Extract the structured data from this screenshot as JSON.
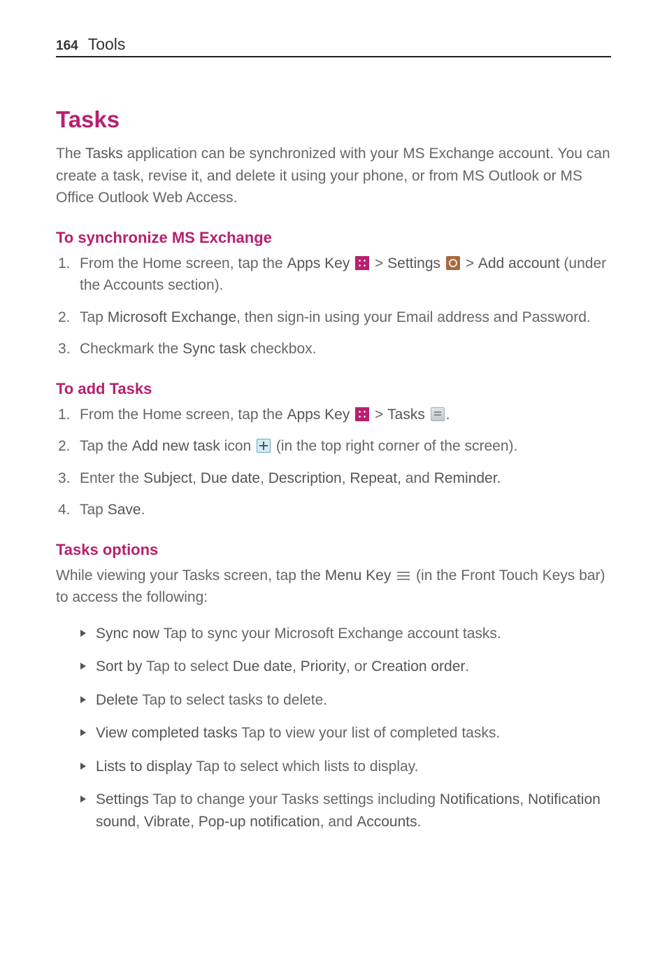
{
  "page_number": "164",
  "section_name": "Tools",
  "title": "Tasks",
  "intro": {
    "pre": "The ",
    "b1": "Tasks",
    "post": " application can be synchronized with your MS Exchange account. You can create a task, revise it, and delete it using your phone, or from MS Outlook or MS Office Outlook Web Access."
  },
  "h_sync": "To synchronize MS Exchange",
  "sync_steps": {
    "s1": {
      "num": "1.",
      "a": "From the Home screen, tap the ",
      "b1": "Apps Key",
      "sep1": " > ",
      "b2": "Settings",
      "sep2": " > ",
      "b3": "Add account",
      "tail": " (under the Accounts section)."
    },
    "s2": {
      "num": "2.",
      "a": "Tap ",
      "b1": "Microsoft Exchange",
      "tail": ", then sign-in using your Email address and Password."
    },
    "s3": {
      "num": "3.",
      "a": "Checkmark the ",
      "b1": "Sync task",
      "tail": " checkbox."
    }
  },
  "h_add": "To add Tasks",
  "add_steps": {
    "s1": {
      "num": "1.",
      "a": "From the Home screen, tap the ",
      "b1": "Apps Key",
      "sep1": " > ",
      "b2": "Tasks",
      "tail": "."
    },
    "s2": {
      "num": "2.",
      "a": "Tap the ",
      "b1": "Add new task",
      "mid": " icon ",
      "tail": " (in the top right corner of the screen)."
    },
    "s3": {
      "num": "3.",
      "a": "Enter the ",
      "b1": "Subject",
      "c1": ", ",
      "b2": "Due date",
      "c2": ", ",
      "b3": "Description",
      "c3": ", ",
      "b4": "Repeat,",
      "c4": " and ",
      "b5": "Reminder."
    },
    "s4": {
      "num": "4.",
      "a": "Tap ",
      "b1": "Save",
      "tail": "."
    }
  },
  "h_opts": "Tasks options",
  "opts_intro": {
    "a": "While viewing your Tasks screen, tap the ",
    "b1": "Menu Key",
    "tail": " (in the Front Touch Keys bar) to access the following:"
  },
  "opts": {
    "o1": {
      "b": "Sync now",
      "t": " Tap to sync your Microsoft Exchange account tasks."
    },
    "o2": {
      "b": "Sort by",
      "t1": " Tap to select ",
      "b2": "Due date",
      "c1": ", ",
      "b3": "Priority",
      "c2": ", or ",
      "b4": "Creation order",
      "tail": "."
    },
    "o3": {
      "b": "Delete",
      "t": " Tap to select tasks to delete."
    },
    "o4": {
      "b": "View completed tasks",
      "t": " Tap to view your list of completed tasks."
    },
    "o5": {
      "b": "Lists to display",
      "t": " Tap to select which lists to display."
    },
    "o6": {
      "b": "Settings",
      "t1": " Tap to change your Tasks settings including ",
      "b2": "Notifications",
      "c1": ", ",
      "b3": "Notification sound",
      "c2": ", ",
      "b4": "Vibrate",
      "c3": ", ",
      "b5": "Pop-up notification",
      "c4": ", and ",
      "b6": "Accounts",
      "tail": "."
    }
  }
}
